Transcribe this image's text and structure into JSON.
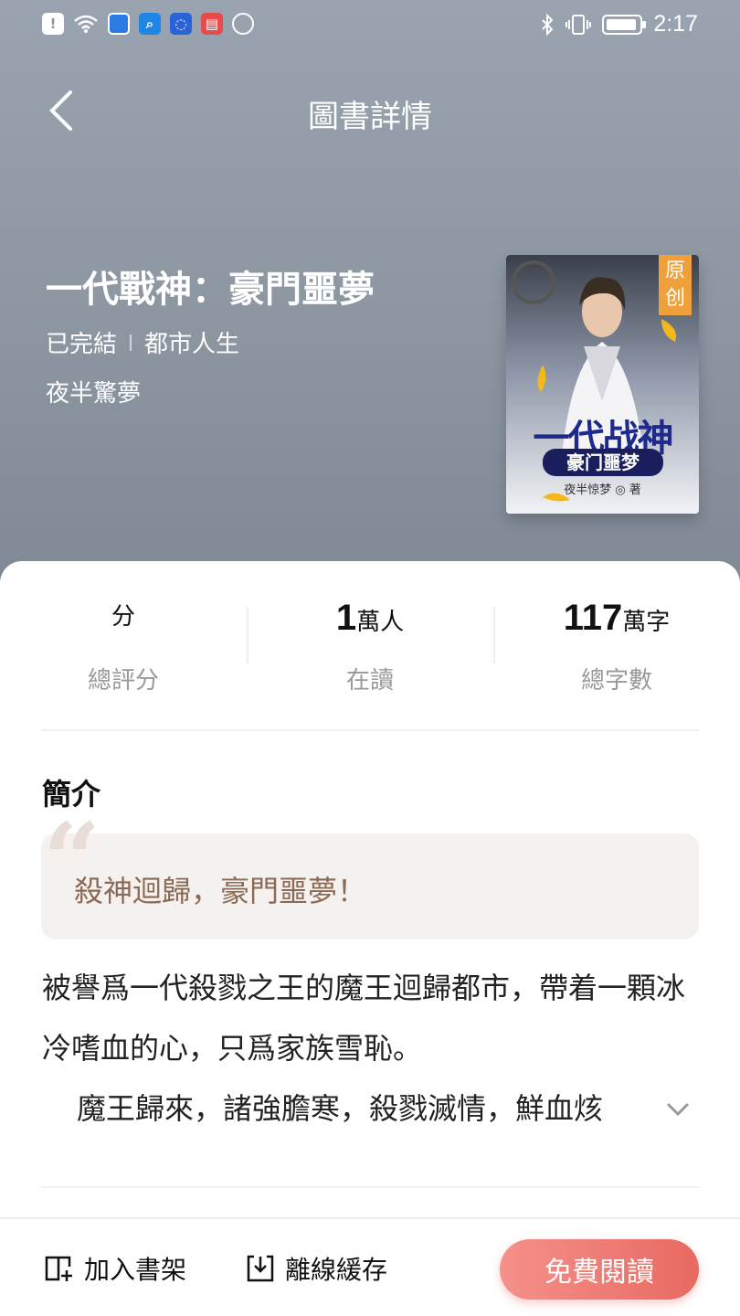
{
  "status_bar": {
    "time": "2:17",
    "left_icons": [
      "alert-icon",
      "wifi-icon",
      "shield-icon",
      "search-app-icon",
      "bulb-app-icon",
      "book-app-icon",
      "globe-icon"
    ],
    "right_icons": [
      "bluetooth-icon",
      "vibrate-icon",
      "battery-icon"
    ]
  },
  "nav": {
    "title": "圖書詳情",
    "back_icon": "chevron-left-icon"
  },
  "book": {
    "title": "一代戰神：豪門噩夢",
    "status": "已完結",
    "category": "都市人生",
    "author": "夜半驚夢",
    "cover": {
      "badge": "原创",
      "title": "一代战神",
      "subtitle": "豪门噩梦",
      "author_line": "夜半惊梦 ◎ 著"
    }
  },
  "stats": [
    {
      "value": "",
      "unit": "分",
      "label": "總評分"
    },
    {
      "value": "1",
      "unit": "萬人",
      "label": "在讀"
    },
    {
      "value": "117",
      "unit": "萬字",
      "label": "總字數"
    }
  ],
  "intro": {
    "heading": "簡介",
    "quote": "殺神迴歸，豪門噩夢！",
    "paragraph1": "被譽爲一代殺戮之王的魔王迴歸都市，帶着一顆冰冷嗜血的心，只爲家族雪恥。",
    "paragraph2": "魔王歸來，諸強膽寒，殺戮滅情，鮮血烗"
  },
  "bottom_bar": {
    "add_shelf": "加入書架",
    "offline_cache": "離線緩存",
    "read_free": "免費閱讀"
  },
  "colors": {
    "header_bg": "#8c96a1",
    "accent": "#e86a62",
    "quote_bg": "#f5f1ee",
    "quote_text": "#8a6a55"
  }
}
